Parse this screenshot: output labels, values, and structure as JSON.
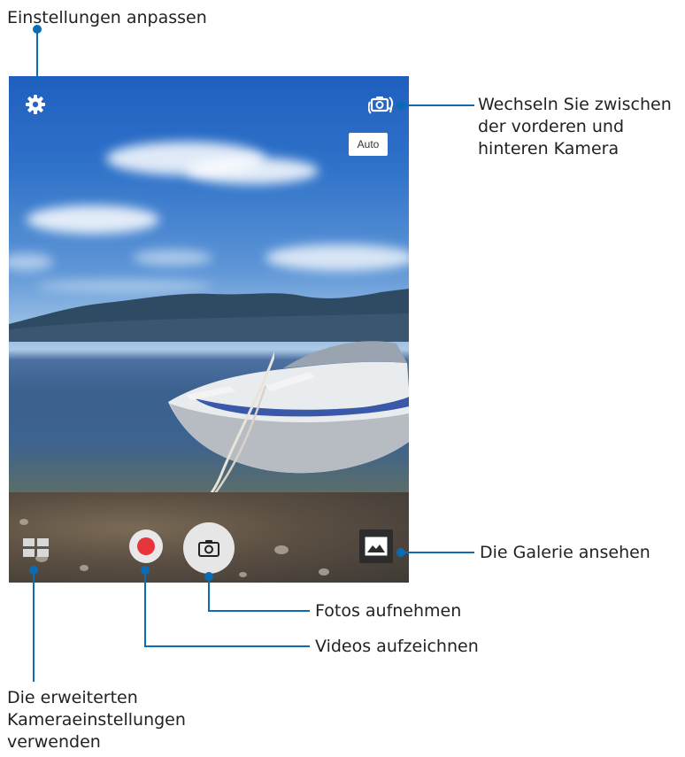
{
  "annotations": {
    "settings": "Einstellungen anpassen",
    "switch_camera": [
      "Wechseln Sie zwischen",
      "der vorderen und",
      "hinteren Kamera"
    ],
    "gallery": "Die Galerie ansehen",
    "photo": "Fotos aufnehmen",
    "video": "Videos aufzeichnen",
    "advanced": [
      "Die erweiterten",
      "Kameraeinstellungen",
      "verwenden"
    ]
  },
  "camera": {
    "mode_button_label": "Auto",
    "icons": {
      "settings": "gear-icon",
      "switch_camera": "switch-camera-icon",
      "advanced_settings": "grid-mode-icon",
      "record": "record-icon",
      "shutter": "camera-icon",
      "gallery": "gallery-icon"
    }
  },
  "colors": {
    "callout_line": "#0b6cb3",
    "record_dot": "#e8343b"
  }
}
